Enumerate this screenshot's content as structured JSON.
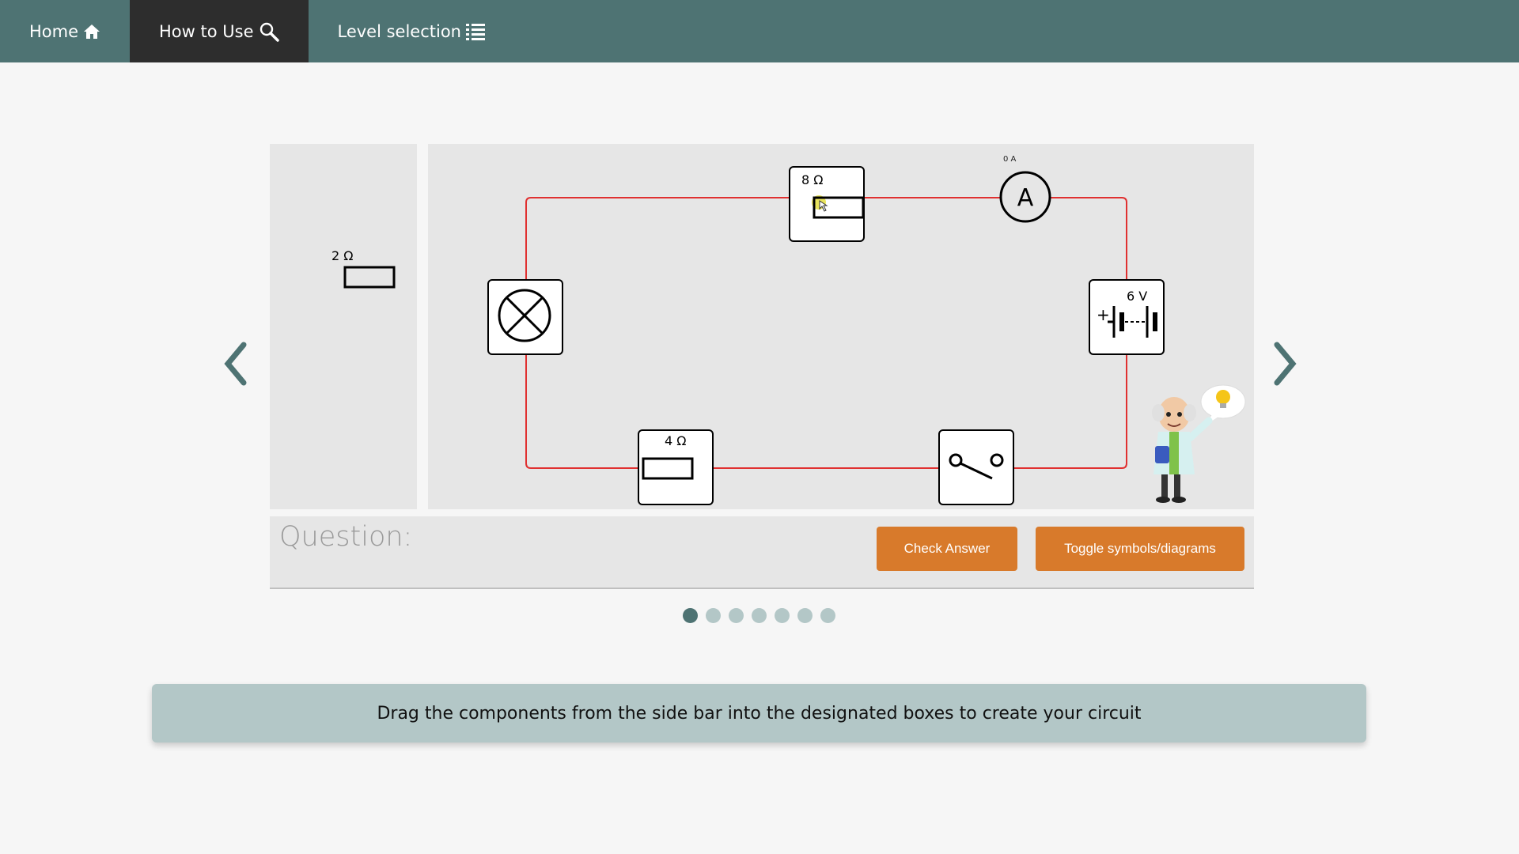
{
  "nav": {
    "items": [
      {
        "label": "Home",
        "icon": "home-icon"
      },
      {
        "label": "How to Use",
        "icon": "search-icon"
      },
      {
        "label": "Level selection",
        "icon": "list-icon"
      }
    ],
    "active_index": 1
  },
  "sidebar": {
    "palette": [
      {
        "label": "2 Ω",
        "type": "resistor"
      }
    ]
  },
  "circuit": {
    "resistor_top_label": "8 Ω",
    "resistor_bottom_label": "4 Ω",
    "battery_label": "6 V",
    "ammeter_reading": "0 A",
    "ammeter_symbol": "A",
    "components": [
      "lamp-icon",
      "resistor-icon",
      "ammeter-icon",
      "battery-icon",
      "switch-icon"
    ]
  },
  "question": {
    "label": "Question:",
    "check_button": "Check Answer",
    "toggle_button": "Toggle symbols/diagrams"
  },
  "pagination": {
    "count": 7,
    "active": 0
  },
  "instruction": "Drag the components from the side bar into the designated boxes to create your circuit",
  "colors": {
    "nav": "#4e7373",
    "nav_active": "#2d2d2d",
    "button": "#d87a2b",
    "wire": "#e03030",
    "panel": "#e6e6e6",
    "instruction_bg": "#b3c7c7"
  }
}
